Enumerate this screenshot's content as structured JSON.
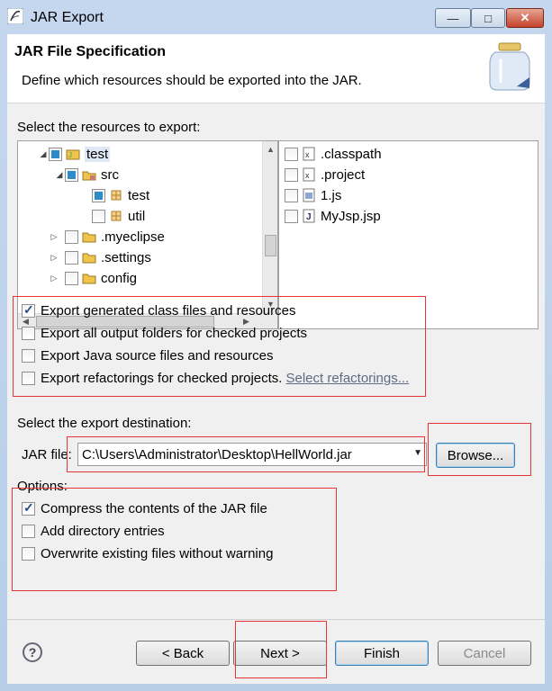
{
  "window": {
    "title": "JAR Export",
    "close_glyph": "✕",
    "maximize_glyph": "□",
    "minimize_glyph": "—"
  },
  "header": {
    "title": "JAR File Specification",
    "description": "Define which resources should be exported into the JAR."
  },
  "resources": {
    "label": "Select the resources to export:",
    "tree": [
      {
        "label": "test",
        "expander": "◢",
        "check": "partial",
        "icon": "project-icon"
      },
      {
        "label": "src",
        "expander": "◢",
        "check": "partial",
        "icon": "source-folder-icon"
      },
      {
        "label": "test",
        "expander": "",
        "check": "partial",
        "icon": "package-icon"
      },
      {
        "label": "util",
        "expander": "",
        "check": "unchecked",
        "icon": "package-icon"
      },
      {
        "label": ".myeclipse",
        "expander": "▷",
        "check": "unchecked",
        "icon": "folder-icon"
      },
      {
        "label": ".settings",
        "expander": "▷",
        "check": "unchecked",
        "icon": "folder-icon"
      },
      {
        "label": "config",
        "expander": "▷",
        "check": "unchecked",
        "icon": "folder-icon"
      }
    ],
    "files": [
      {
        "label": ".classpath",
        "icon": "xml-file-icon"
      },
      {
        "label": ".project",
        "icon": "xml-file-icon"
      },
      {
        "label": "1.js",
        "icon": "js-file-icon"
      },
      {
        "label": "MyJsp.jsp",
        "icon": "jsp-file-icon"
      }
    ]
  },
  "export_options": [
    {
      "label": "Export generated class files and resources",
      "checked": true
    },
    {
      "label": "Export all output folders for checked projects",
      "checked": false
    },
    {
      "label": "Export Java source files and resources",
      "checked": false
    },
    {
      "label": "Export refactorings for checked projects.",
      "checked": false,
      "link": "Select refactorings..."
    }
  ],
  "destination": {
    "label": "Select the export destination:",
    "jar_file_label": "JAR file:",
    "jar_file_value": "C:\\Users\\Administrator\\Desktop\\HellWorld.jar",
    "browse_label": "Browse..."
  },
  "options": {
    "label": "Options:",
    "items": [
      {
        "label": "Compress the contents of the JAR file",
        "checked": true
      },
      {
        "label": "Add directory entries",
        "checked": false
      },
      {
        "label": "Overwrite existing files without warning",
        "checked": false
      }
    ]
  },
  "footer": {
    "help_glyph": "?",
    "back_label": "< Back",
    "next_label": "Next >",
    "finish_label": "Finish",
    "cancel_label": "Cancel"
  },
  "colors": {
    "highlight_box": "#e53535",
    "checkbox_fill": "#2e8bc9"
  }
}
